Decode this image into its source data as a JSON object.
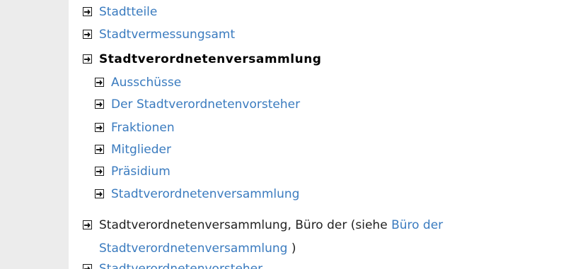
{
  "items": [
    {
      "label": "Stadtteile"
    },
    {
      "label": "Stadtvermessungsamt"
    },
    {
      "label": "Stadtverordnetenversammlung"
    },
    {
      "label": "Ausschüsse"
    },
    {
      "label": "Der Stadtverordnetenvorsteher"
    },
    {
      "label": "Fraktionen"
    },
    {
      "label": "Mitglieder"
    },
    {
      "label": "Präsidium"
    },
    {
      "label": "Stadtverordnetenversammlung"
    }
  ],
  "buero_entry": {
    "prefix": "Stadtverordnetenversammlung, Büro der (siehe ",
    "link_part1": "Büro der",
    "link_part2": "Stadtverordnetenversammlung",
    "suffix": " )"
  },
  "cutoff_entry": {
    "label": "Stadtverordnetenvorsteher"
  },
  "colors": {
    "link": "#3a7bbf",
    "gutter": "#ececec"
  },
  "icons": {
    "bullet": "arrow-into-box-icon"
  }
}
